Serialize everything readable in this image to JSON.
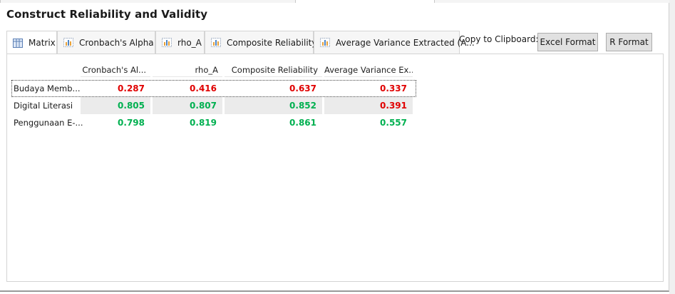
{
  "title": "Construct Reliability and Validity",
  "tabs": [
    {
      "label": "Matrix"
    },
    {
      "label": "Cronbach's Alpha"
    },
    {
      "label": "rho_A"
    },
    {
      "label": "Composite Reliability"
    },
    {
      "label": "Average Variance Extracted (A..."
    }
  ],
  "clipboard": {
    "label": "Copy to Clipboard:",
    "excel": "Excel Format",
    "r": "R Format"
  },
  "table": {
    "headers": [
      "Cronbach's Al...",
      "rho_A",
      "Composite Reliability",
      "Average Variance Ex..."
    ],
    "rows": [
      {
        "label": "Budaya Memb...",
        "values": [
          "0.287",
          "0.416",
          "0.637",
          "0.337"
        ],
        "status": [
          "bad",
          "bad",
          "bad",
          "bad"
        ]
      },
      {
        "label": "Digital Literasi",
        "values": [
          "0.805",
          "0.807",
          "0.852",
          "0.391"
        ],
        "status": [
          "good",
          "good",
          "good",
          "bad"
        ]
      },
      {
        "label": "Penggunaan E-...",
        "values": [
          "0.798",
          "0.819",
          "0.861",
          "0.557"
        ],
        "status": [
          "good",
          "good",
          "good",
          "good"
        ]
      }
    ]
  },
  "colors": {
    "good": "#00b050",
    "bad": "#e00000"
  }
}
